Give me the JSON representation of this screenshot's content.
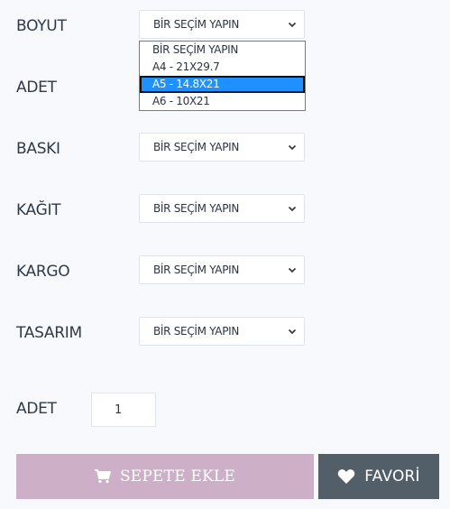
{
  "fields": {
    "boyut": {
      "label": "BOYUT",
      "value": "BİR SEÇİM YAPIN"
    },
    "adet_select": {
      "label": "ADET"
    },
    "baski": {
      "label": "BASKI",
      "value": "BİR SEÇİM YAPIN"
    },
    "kagit": {
      "label": "KAĞIT",
      "value": "BİR SEÇİM YAPIN"
    },
    "kargo": {
      "label": "KARGO",
      "value": "BİR SEÇİM YAPIN"
    },
    "tasarim": {
      "label": "TASARIM",
      "value": "BİR SEÇİM YAPIN"
    }
  },
  "boyut_options": [
    "BİR SEÇİM YAPIN",
    "A4 - 21X29.7",
    "A5 - 14.8X21",
    "A6 - 10X21"
  ],
  "boyut_highlighted": "A5 - 14.8X21",
  "quantity": {
    "label": "ADET",
    "value": "1"
  },
  "buttons": {
    "add_to_cart": "SEPETE EKLE",
    "favorite": "FAVORİ"
  },
  "colors": {
    "cart_button": "#cdb0c8",
    "favorite_button": "#525f69",
    "highlight": "#1e90ff"
  },
  "icons": {
    "cart": "cart-icon",
    "favorite": "heart-icon",
    "chevron": "chevron-down-icon"
  }
}
